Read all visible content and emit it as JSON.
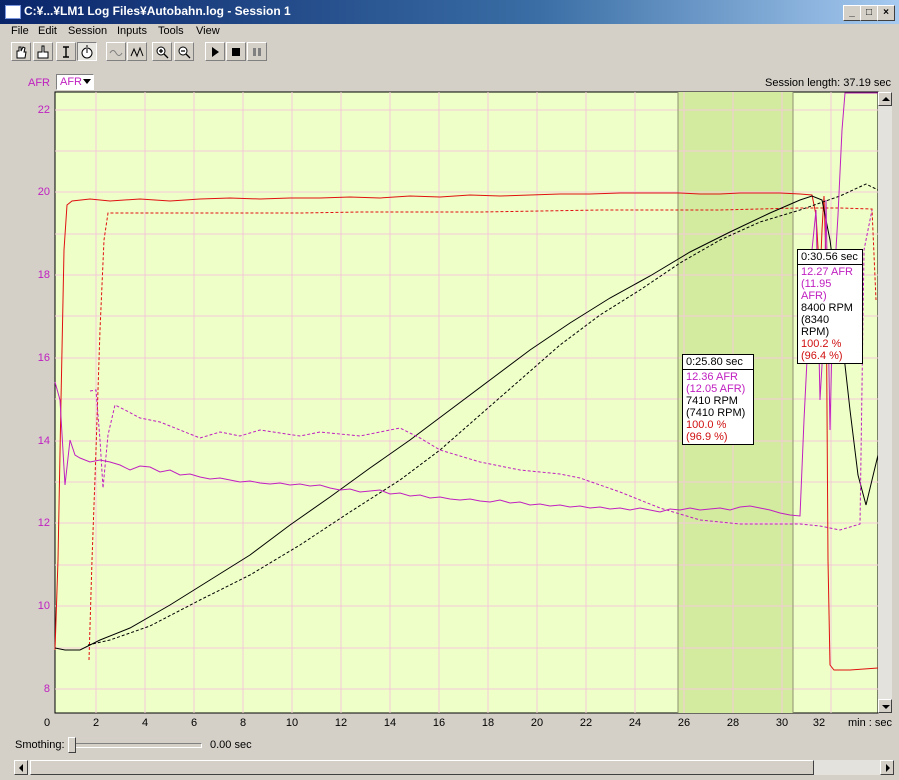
{
  "window": {
    "title": "C:¥...¥LM1 Log Files¥Autobahn.log - Session 1"
  },
  "menu": [
    "File",
    "Edit",
    "Session",
    "Inputs",
    "Tools",
    "View"
  ],
  "toolbar_icons": [
    "hand-icon",
    "hand-point-icon",
    "text-cursor-icon",
    "stopwatch-icon",
    "wave-icon",
    "peak-icon",
    "zoom-in-icon",
    "zoom-out-icon",
    "play-icon",
    "stop-icon",
    "pause-icon"
  ],
  "axis": {
    "afr_label": "AFR",
    "channel_select": "AFR",
    "session_length": "Session length:  37.19 sec",
    "x_unit": "min : sec",
    "y_ticks": [
      "22",
      "20",
      "18",
      "16",
      "14",
      "12",
      "10",
      "8"
    ],
    "x_ticks": [
      "0",
      "2",
      "4",
      "6",
      "8",
      "10",
      "12",
      "14",
      "16",
      "18",
      "20",
      "22",
      "24",
      "26",
      "28",
      "30",
      "32"
    ]
  },
  "colors": {
    "plot_bg": "#eeffc8",
    "selection": "#d3eb9f",
    "afr": "#c020c0",
    "rpm": "#000000",
    "tps": "#e01010",
    "grid": "#f4c8d8"
  },
  "tooltip1": {
    "time": "0:25.80 sec",
    "afr": "12.36 AFR",
    "afr_ref": "(12.05 AFR)",
    "rpm": "7410 RPM",
    "rpm_ref": "(7410 RPM)",
    "pct": "100.0 %",
    "pct_ref": "(96.9 %)"
  },
  "tooltip2": {
    "time": "0:30.56 sec",
    "afr": "12.27 AFR",
    "afr_ref": "(11.95 AFR)",
    "rpm": "8400 RPM",
    "rpm_ref": "(8340 RPM)",
    "pct": "100.2 %",
    "pct_ref": "(96.4 %)"
  },
  "smoothing": {
    "label": "Smothing:",
    "value": "0.00 sec"
  }
}
